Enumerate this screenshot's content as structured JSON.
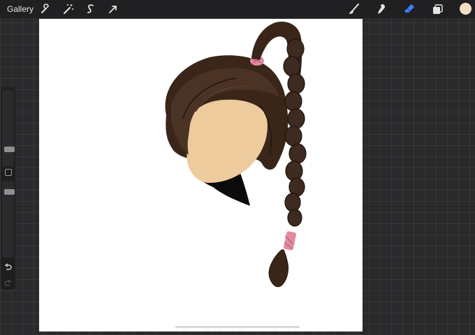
{
  "topbar": {
    "gallery_label": "Gallery",
    "tools_left": [
      "wrench-icon",
      "magic-wand-icon",
      "selection-s-icon",
      "transform-arrow-icon"
    ],
    "tools_right": [
      "brush-icon",
      "smudge-icon",
      "eraser-icon",
      "layers-icon",
      "color-swatch"
    ]
  },
  "colors": {
    "accent": "#3b82f6",
    "swatch": "#f5dec4",
    "hair": "#3d2a20",
    "skin": "#eecb9d",
    "tie": "#e48aa0"
  },
  "sidebar": {
    "brush_size_level": 0.8,
    "opacity_level": 0.55
  }
}
